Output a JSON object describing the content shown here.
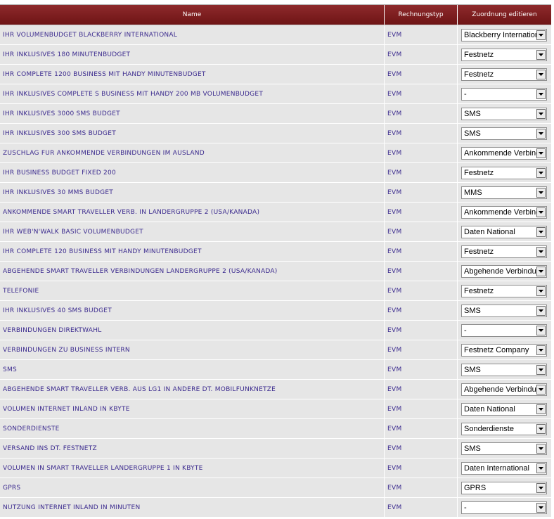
{
  "table": {
    "headers": {
      "name": "Name",
      "rechnungstyp": "Rechnungstyp",
      "zuordnung": "Zuordnung editieren"
    },
    "rows": [
      {
        "name": "IHR VOLUMENBUDGET BLACKBERRY INTERNATIONAL",
        "typ": "EVM",
        "zuordnung": "Blackberry International"
      },
      {
        "name": "IHR INKLUSIVES 180 MINUTENBUDGET",
        "typ": "EVM",
        "zuordnung": "Festnetz"
      },
      {
        "name": "IHR COMPLETE 1200 BUSINESS MIT HANDY MINUTENBUDGET",
        "typ": "EVM",
        "zuordnung": "Festnetz"
      },
      {
        "name": "IHR INKLUSIVES COMPLETE S BUSINESS MIT HANDY 200 MB VOLUMENBUDGET",
        "typ": "EVM",
        "zuordnung": "-"
      },
      {
        "name": "IHR INKLUSIVES 3000 SMS BUDGET",
        "typ": "EVM",
        "zuordnung": "SMS"
      },
      {
        "name": "IHR INKLUSIVES 300 SMS BUDGET",
        "typ": "EVM",
        "zuordnung": "SMS"
      },
      {
        "name": "ZUSCHLAG FUR ANKOMMENDE VERBINDUNGEN IM AUSLAND",
        "typ": "EVM",
        "zuordnung": "Ankommende Verbindungen"
      },
      {
        "name": "IHR BUSINESS BUDGET FIXED 200",
        "typ": "EVM",
        "zuordnung": "Festnetz"
      },
      {
        "name": "IHR INKLUSIVES 30 MMS BUDGET",
        "typ": "EVM",
        "zuordnung": "MMS"
      },
      {
        "name": "ANKOMMENDE SMART TRAVELLER VERB. IN LANDERGRUPPE 2 (USA/KANADA)",
        "typ": "EVM",
        "zuordnung": "Ankommende Verbindungen"
      },
      {
        "name": "IHR WEB'N'WALK BASIC VOLUMENBUDGET",
        "typ": "EVM",
        "zuordnung": "Daten National"
      },
      {
        "name": "IHR COMPLETE 120 BUSINESS MIT HANDY MINUTENBUDGET",
        "typ": "EVM",
        "zuordnung": "Festnetz"
      },
      {
        "name": "ABGEHENDE SMART TRAVELLER VERBINDUNGEN LANDERGRUPPE 2 (USA/KANADA)",
        "typ": "EVM",
        "zuordnung": "Abgehende Verbindungen"
      },
      {
        "name": "TELEFONIE",
        "typ": "EVM",
        "zuordnung": "Festnetz"
      },
      {
        "name": "IHR INKLUSIVES 40 SMS BUDGET",
        "typ": "EVM",
        "zuordnung": "SMS"
      },
      {
        "name": "VERBINDUNGEN DIREKTWAHL",
        "typ": "EVM",
        "zuordnung": "-"
      },
      {
        "name": "VERBINDUNGEN ZU BUSINESS INTERN",
        "typ": "EVM",
        "zuordnung": "Festnetz Company"
      },
      {
        "name": "SMS",
        "typ": "EVM",
        "zuordnung": "SMS"
      },
      {
        "name": "ABGEHENDE SMART TRAVELLER VERB. AUS LG1 IN ANDERE DT. MOBILFUNKNETZE",
        "typ": "EVM",
        "zuordnung": "Abgehende Verbindungen"
      },
      {
        "name": "VOLUMEN INTERNET INLAND IN KBYTE",
        "typ": "EVM",
        "zuordnung": "Daten National"
      },
      {
        "name": "SONDERDIENSTE",
        "typ": "EVM",
        "zuordnung": "Sonderdienste"
      },
      {
        "name": "VERSAND INS DT. FESTNETZ",
        "typ": "EVM",
        "zuordnung": "SMS"
      },
      {
        "name": "VOLUMEN IN SMART TRAVELLER LANDERGRUPPE 1 IN KBYTE",
        "typ": "EVM",
        "zuordnung": "Daten International"
      },
      {
        "name": "GPRS",
        "typ": "EVM",
        "zuordnung": "GPRS"
      },
      {
        "name": "NUTZUNG INTERNET INLAND IN MINUTEN",
        "typ": "EVM",
        "zuordnung": "-"
      }
    ]
  },
  "icons": {
    "dropdown": "chevron-down-icon"
  },
  "colors": {
    "header_bg": "#7d1e20",
    "row_bg": "#e6e6e6",
    "link_text": "#3b2a8e"
  }
}
